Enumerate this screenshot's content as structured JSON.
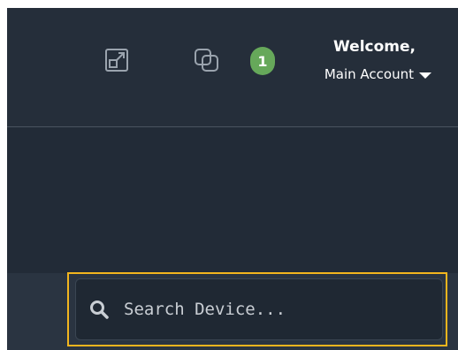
{
  "header": {
    "welcome_label": "Welcome,",
    "account_label": "Main Account",
    "notification_count": "1",
    "icons": {
      "expand": "expand-icon",
      "switch": "switch-window-icon",
      "caret": "caret-down-icon"
    }
  },
  "search": {
    "placeholder": "Search Device..."
  },
  "colors": {
    "background": "#222b37",
    "header_background": "#252e3a",
    "search_background": "#1f2833",
    "highlight_outline": "#f2b51e",
    "badge": "#66a85a"
  }
}
